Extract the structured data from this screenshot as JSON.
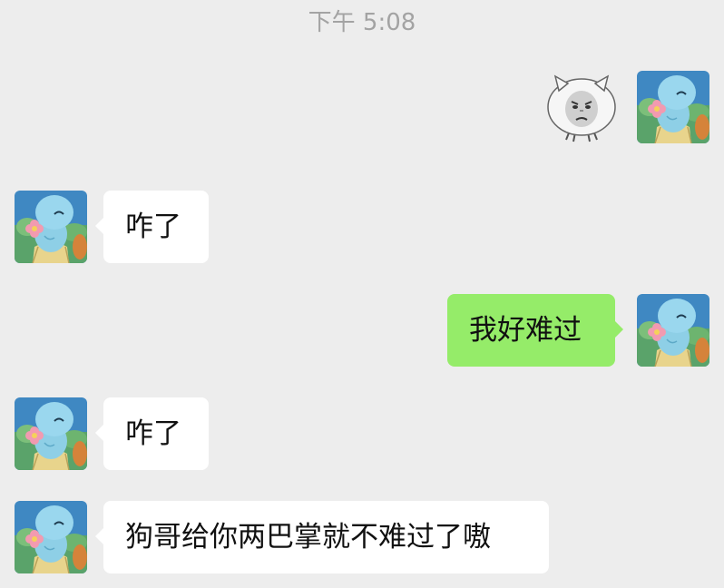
{
  "chat": {
    "timestamp": "下午 5:08",
    "messages": [
      {
        "sender": "self",
        "type": "sticker",
        "sticker_icon": "face-meme-sticker"
      },
      {
        "sender": "other",
        "type": "text",
        "text": "咋了"
      },
      {
        "sender": "self",
        "type": "text",
        "text": "我好难过"
      },
      {
        "sender": "other",
        "type": "text",
        "text": "咋了"
      },
      {
        "sender": "other",
        "type": "text",
        "text": "狗哥给你两巴掌就不难过了嗷"
      }
    ]
  },
  "colors": {
    "background": "#ededed",
    "incoming_bubble": "#ffffff",
    "outgoing_bubble": "#95ec69",
    "timestamp_text": "#a3a3a3"
  },
  "avatar_icon": "squirtle-avatar"
}
